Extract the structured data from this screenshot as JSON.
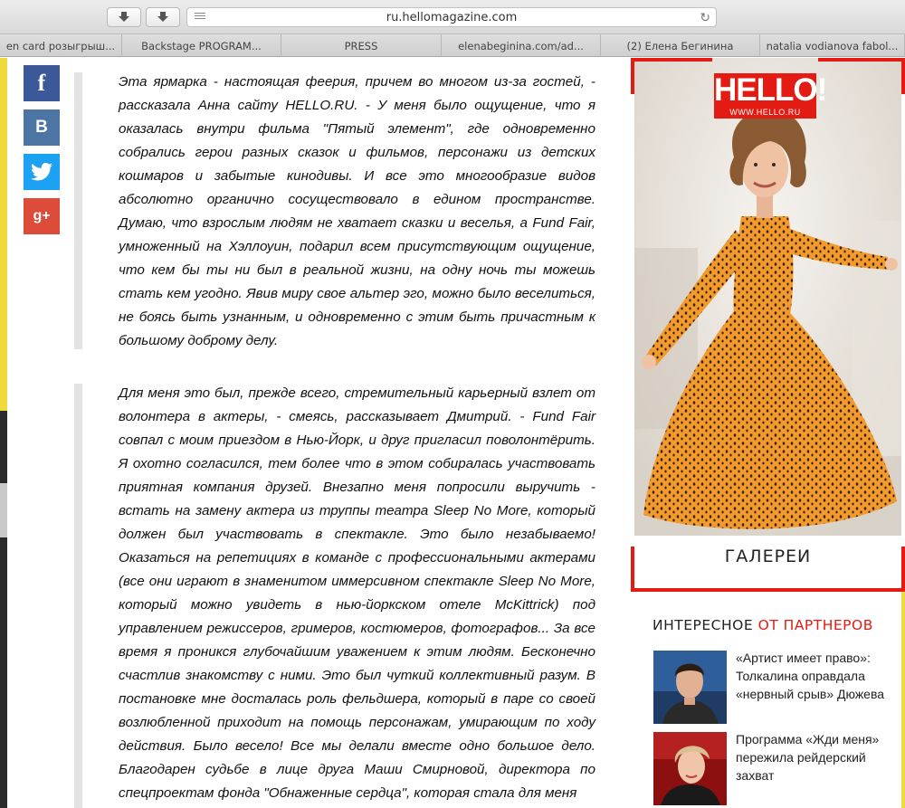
{
  "browser": {
    "url": "ru.hellomagazine.com",
    "bookmarks": [
      "en card розыгрыш...",
      "Backstage PROGRAM...",
      "PRESS",
      "elenabeginina.com/ad...",
      "(2) Елена Бегинина",
      "natalia vodianova fabol..."
    ]
  },
  "share": {
    "facebook": "f",
    "vk": "B",
    "gplus": "g+"
  },
  "article": {
    "paragraph1": "Эта ярмарка - настоящая феерия, причем во многом из-за гостей, - рассказала Анна сайту HELLO.RU. - У меня было ощущение, что я оказалась внутри фильма \"Пятый элемент\", где одновременно собрались герои разных сказок и фильмов, персонажи из детских кошмаров и забытые кинодивы. И все это многообразие видов абсолютно органично сосуществовало в едином пространстве. Думаю, что взрослым людям не хватает сказки и веселья, а Fund Fair, умноженный на Хэллоуин, подарил всем присутствующим ощущение, что кем бы ты ни был в реальной жизни, на одну ночь ты можешь стать кем угодно. Явив миру свое альтер эго, можно было веселиться, не боясь быть узнанным, и одновременно с этим быть причастным к большому доброму делу.",
    "paragraph2": "Для меня это был, прежде всего, стремительный карьерный взлет от волонтера в актеры, - смеясь, рассказывает Дмитрий. - Fund Fair совпал с моим приездом в Нью-Йорк, и друг пригласил поволонтёрить. Я охотно согласился, тем более что в этом собиралась участвовать приятная компания друзей. Внезапно меня попросили выручить - встать на замену актера из труппы театра Sleep No More, который должен был участвовать в спектакле. Это было незабываемо! Оказаться на репетициях в команде с профессиональными актерами (все они играют в знаменитом иммерсивном спектакле Sleep No More, который можно увидеть в нью-йоркском отеле McKittrick) под управлением режиссеров, гримеров, костюмеров, фотографов... За все время я проникся глубочайшим уважением к этим людям. Бесконечно счастлив знакомству с ними. Это был чуткий коллективный разум. В постановке мне досталась роль фельдшера, который в паре со своей возлюбленной приходит на помощь персонажам, умирающим по ходу действия. Было весело! Все мы делали вместе одно большое дело. Благодарен судьбе в лице друга Маши Смирновой, директора по спецпроектам фонда \"Обнаженные сердца\", которая стала для меня"
  },
  "ad": {
    "brand": "HELLO!",
    "site": "WWW.HELLO.RU",
    "label": "ГАЛЕРЕИ"
  },
  "partners": {
    "title_main": "ИНТЕРЕСНОЕ",
    "title_accent": "ОТ ПАРТНЕРОВ",
    "items": [
      {
        "text": "«Артист имеет право»: Толкалина оправдала «нервный срыв» Дюжева"
      },
      {
        "text": "Программа «Жди меня» пережила рейдерский захват"
      }
    ]
  },
  "colors": {
    "accent": "#e41b13",
    "facebook": "#3b5998",
    "vk": "#4c75a3",
    "twitter": "#1da1f2",
    "gplus": "#dd4b39",
    "dress": "#f39a2c"
  }
}
